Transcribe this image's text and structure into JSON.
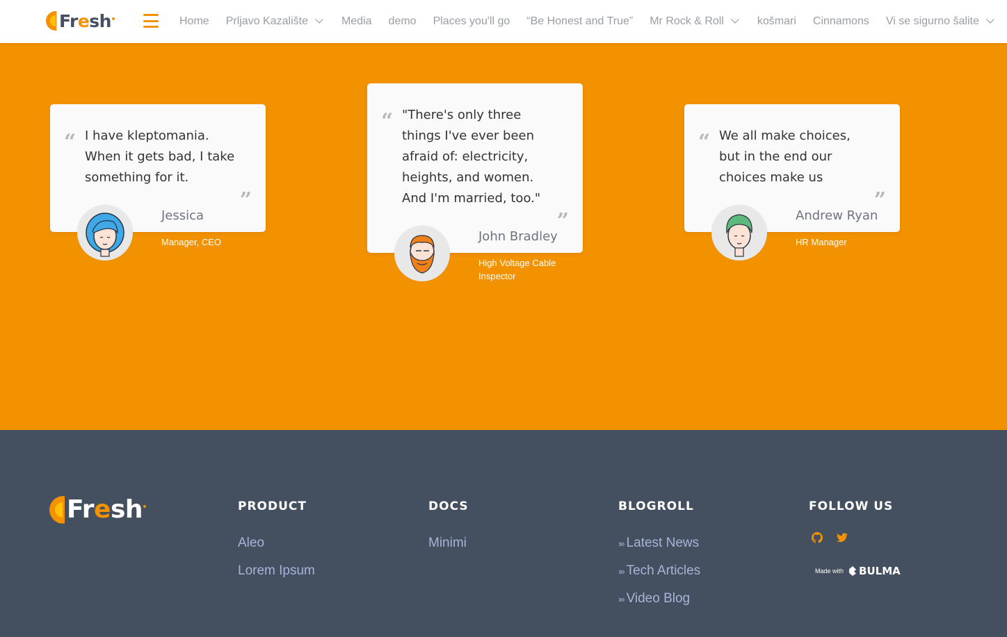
{
  "brand": {
    "logo_text_a": "Fr",
    "logo_text_e": "e",
    "logo_text_b": "sh"
  },
  "nav": {
    "items": [
      {
        "label": "Home",
        "dropdown": false
      },
      {
        "label": "Prljavo Kazalište",
        "dropdown": true
      },
      {
        "label": "Media",
        "dropdown": false
      },
      {
        "label": "demo",
        "dropdown": false
      },
      {
        "label": "Places you'll go",
        "dropdown": false
      },
      {
        "label": "“Be Honest and True”",
        "dropdown": false
      },
      {
        "label": "Mr Rock & Roll",
        "dropdown": true
      },
      {
        "label": "košmari",
        "dropdown": false
      },
      {
        "label": "Cinnamons",
        "dropdown": false
      },
      {
        "label": "Vi se sigurno šalite",
        "dropdown": true
      }
    ]
  },
  "testimonials": [
    {
      "quote_lines": [
        "I have kleptomania.",
        "When it gets bad, I take",
        "something for it."
      ],
      "name": "Jessica",
      "role": "Manager, CEO",
      "avatar": "woman-blue-hair-avatar"
    },
    {
      "quote_lines": [
        "\"There's only three",
        "things I've ever been",
        "afraid of: electricity,",
        "heights, and women.",
        "And I'm married, too.\""
      ],
      "name": "John Bradley",
      "role_lines": [
        "High Voltage Cable",
        "Inspector"
      ],
      "avatar": "bearded-man-avatar"
    },
    {
      "quote_lines": [
        "We all make choices,",
        "but in the end our",
        "choices make us"
      ],
      "name": "Andrew Ryan",
      "role": "HR Manager",
      "avatar": "man-green-hair-avatar"
    }
  ],
  "quote_marks": {
    "open": "“",
    "close": "”"
  },
  "footer": {
    "columns": [
      {
        "title": "PRODUCT",
        "links": [
          "Aleo",
          "Lorem Ipsum"
        ]
      },
      {
        "title": "DOCS",
        "links": [
          "Minimi"
        ]
      },
      {
        "title": "BLOGROLL",
        "links": [
          "Latest News",
          "Tech Articles",
          "Video Blog"
        ],
        "prefix": "›»"
      },
      {
        "title": "FOLLOW US",
        "links": []
      }
    ],
    "social_icons": [
      "github-icon",
      "twitter-icon"
    ],
    "made_with": "Made with",
    "bulma": "BULMA"
  },
  "colors": {
    "accent": "#f39200",
    "footer_bg": "#444f60",
    "footer_link": "#a8b3d8",
    "nav_text": "#999ea5"
  }
}
